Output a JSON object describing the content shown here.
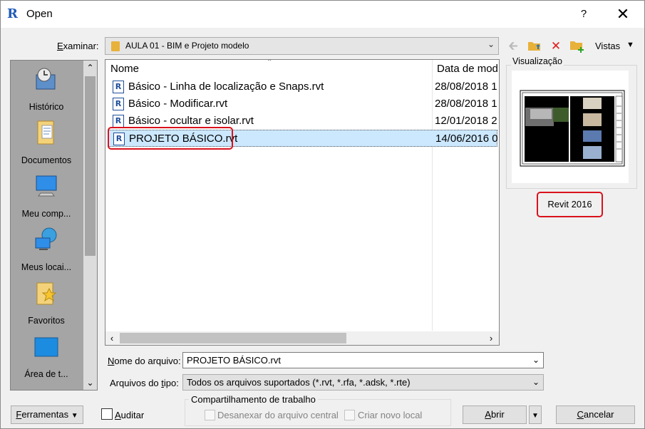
{
  "window": {
    "title": "Open",
    "help_glyph": "?",
    "close_glyph": "✕"
  },
  "lookin": {
    "label_prefix": "E",
    "label_rest": "xaminar:",
    "value": "AULA 01 - BIM e Projeto modelo"
  },
  "toolbar": {
    "views_label": "Vistas"
  },
  "places": [
    {
      "label": "Histórico",
      "icon": "history-icon"
    },
    {
      "label": "Documentos",
      "icon": "documents-icon"
    },
    {
      "label": "Meu comp...",
      "icon": "computer-icon"
    },
    {
      "label": "Meus locai...",
      "icon": "network-icon"
    },
    {
      "label": "Favoritos",
      "icon": "favorites-icon"
    },
    {
      "label": "Área de t...",
      "icon": "desktop-icon"
    }
  ],
  "filelist": {
    "col_name": "Nome",
    "col_date": "Data de mod",
    "files": [
      {
        "name": "Básico - Linha de localização e Snaps.rvt",
        "date": "28/08/2018 1"
      },
      {
        "name": "Básico - Modificar.rvt",
        "date": "28/08/2018 1"
      },
      {
        "name": "Básico - ocultar e isolar.rvt",
        "date": "12/01/2018 2"
      },
      {
        "name": "PROJETO BÁSICO.rvt",
        "date": "14/06/2016 0",
        "selected": true
      }
    ]
  },
  "preview": {
    "label": "Visualização",
    "version": "Revit 2016"
  },
  "filename": {
    "label_prefix": "N",
    "label_rest": "ome do arquivo:",
    "value": "PROJETO BÁSICO.rvt"
  },
  "filetype": {
    "label_pre": "Arquivos do ",
    "label_u": "t",
    "label_post": "ipo:",
    "value": "Todos os arquivos suportados  (*.rvt, *.rfa, *.adsk, *.rte)"
  },
  "worksharing": {
    "title": "Compartilhamento de trabalho",
    "detach": "Desanexar do arquivo central",
    "new_local": "Criar novo local"
  },
  "buttons": {
    "tools_u": "F",
    "tools_rest": "erramentas",
    "audit_u": "A",
    "audit_rest": "uditar",
    "open_u": "A",
    "open_rest": "brir",
    "cancel_u": "C",
    "cancel_rest": "ancelar"
  }
}
